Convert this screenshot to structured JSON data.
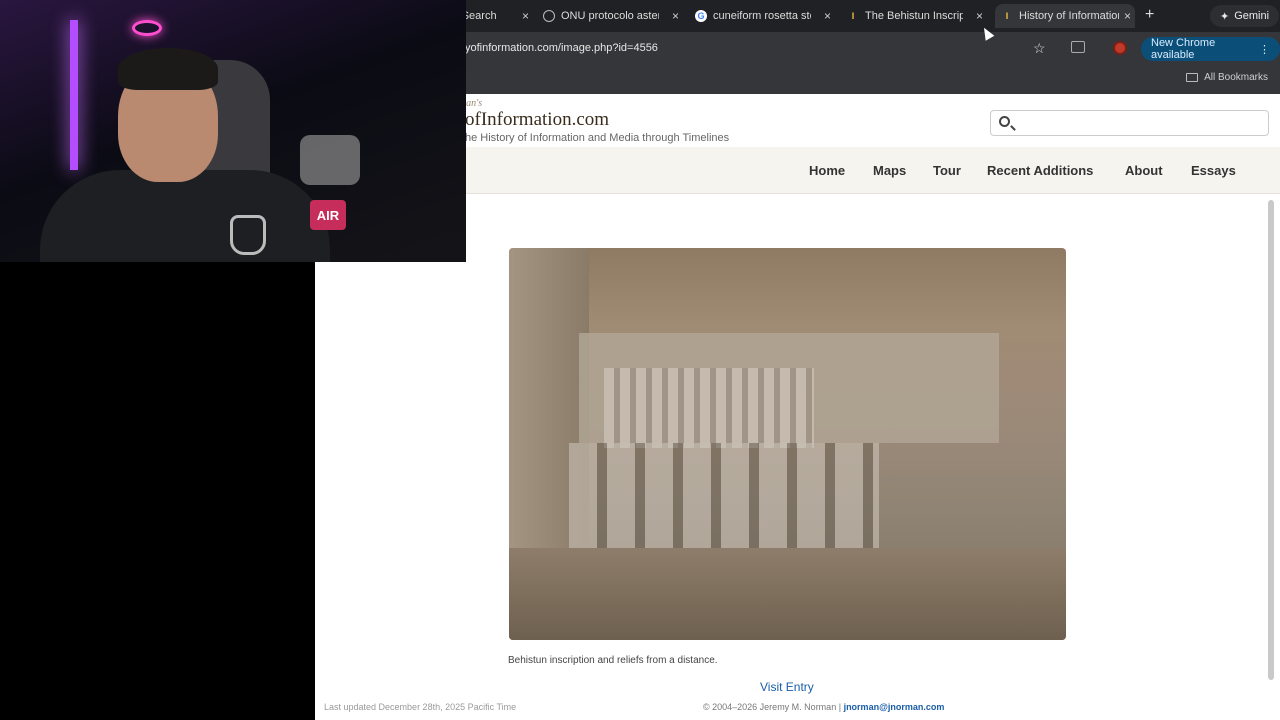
{
  "browser": {
    "tabs": [
      {
        "title": "- Search",
        "icon": "search-favicon"
      },
      {
        "title": "ONU protocolo aster",
        "icon": "globe-favicon"
      },
      {
        "title": "cuneiform rosetta sto",
        "icon": "google-favicon"
      },
      {
        "title": "The Behistun Inscript",
        "icon": "site-favicon"
      },
      {
        "title": "History of Information",
        "icon": "site-favicon",
        "active": true
      }
    ],
    "new_tab_symbol": "+",
    "gemini_label": "Gemini",
    "url": "yofinformation.com/image.php?id=4556",
    "new_chrome_label": "New Chrome available",
    "all_bookmarks_label": "All Bookmarks",
    "close_symbol": "×"
  },
  "site": {
    "brand_top": "rman's",
    "brand": "ofInformation.com",
    "tagline": "he History of Information and Media through Timelines",
    "search_placeholder": "",
    "nav": [
      "Home",
      "Maps",
      "Tour",
      "Recent Additions",
      "About",
      "Essays"
    ]
  },
  "content": {
    "image_alt": "Behistun inscription and reliefs from a distance.",
    "caption": "Behistun inscription and reliefs from a distance.",
    "visit_entry": "Visit Entry"
  },
  "footer": {
    "last_updated": "Last updated December 28th, 2025 Pacific Time",
    "copyright": "© 2004–2026 Jeremy M. Norman |",
    "email": "jnorman@jnorman.com"
  },
  "webcam": {
    "sign_text": "AIR"
  },
  "colors": {
    "chrome_dark": "#202124",
    "link_blue": "#1a5ea8",
    "new_chrome_button": "#0b4f78"
  }
}
